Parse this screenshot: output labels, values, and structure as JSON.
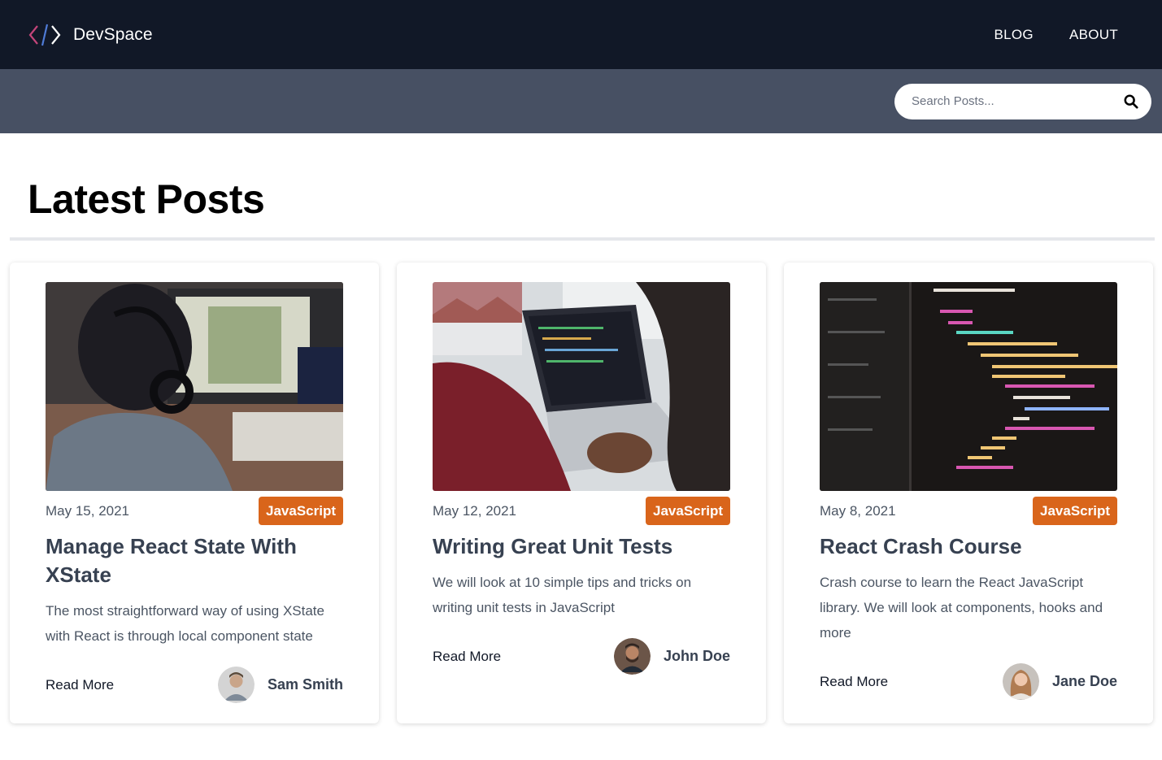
{
  "brand": {
    "name": "DevSpace",
    "logo_icon": "code-brackets-icon"
  },
  "nav": {
    "items": [
      {
        "label": "BLOG"
      },
      {
        "label": "ABOUT"
      }
    ]
  },
  "search": {
    "placeholder": "Search Posts...",
    "icon": "search-icon"
  },
  "page": {
    "title": "Latest Posts"
  },
  "posts": [
    {
      "date": "May 15, 2021",
      "category": "JavaScript",
      "title": "Manage React State With XState",
      "excerpt": "The most straightforward way of using XState with React is through local component state",
      "read_more": "Read More",
      "author": "Sam Smith"
    },
    {
      "date": "May 12, 2021",
      "category": "JavaScript",
      "title": "Writing Great Unit Tests",
      "excerpt": "We will look at 10 simple tips and tricks on writing unit tests in JavaScript",
      "read_more": "Read More",
      "author": "John Doe"
    },
    {
      "date": "May 8, 2021",
      "category": "JavaScript",
      "title": "React Crash Course",
      "excerpt": "Crash course to learn the React JavaScript library. We will look at components, hooks and more",
      "read_more": "Read More",
      "author": "Jane Doe"
    }
  ],
  "colors": {
    "nav_bg": "#111827",
    "search_bar_bg": "#475063",
    "tag_bg": "#d9651b"
  }
}
